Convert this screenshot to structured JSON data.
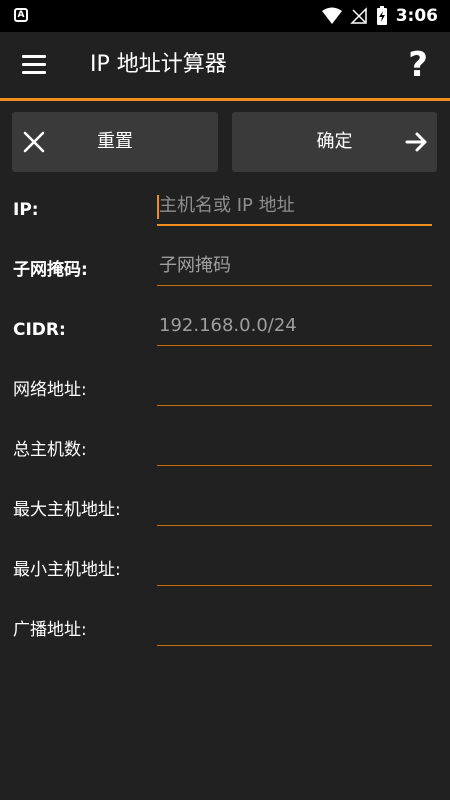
{
  "status_bar": {
    "app_badge": "A",
    "time": "3:06",
    "icons": [
      "wifi-icon",
      "signal-off-icon",
      "battery-charging-icon"
    ]
  },
  "toolbar": {
    "title": "IP 地址计算器",
    "help": "?",
    "menu_icon": "hamburger-menu-icon",
    "accent_color": "#ef8e1e"
  },
  "buttons": {
    "reset_label": "重置",
    "confirm_label": "确定"
  },
  "form": {
    "ip_label": "IP:",
    "ip_placeholder": "主机名或 IP 地址",
    "mask_label": "子网掩码:",
    "mask_placeholder": "子网掩码",
    "cidr_label": "CIDR:",
    "cidr_placeholder": "192.168.0.0/24",
    "network_label": "网络地址:",
    "hosts_label": "总主机数:",
    "max_host_label": "最大主机地址:",
    "min_host_label": "最小主机地址:",
    "broadcast_label": "广播地址:"
  }
}
